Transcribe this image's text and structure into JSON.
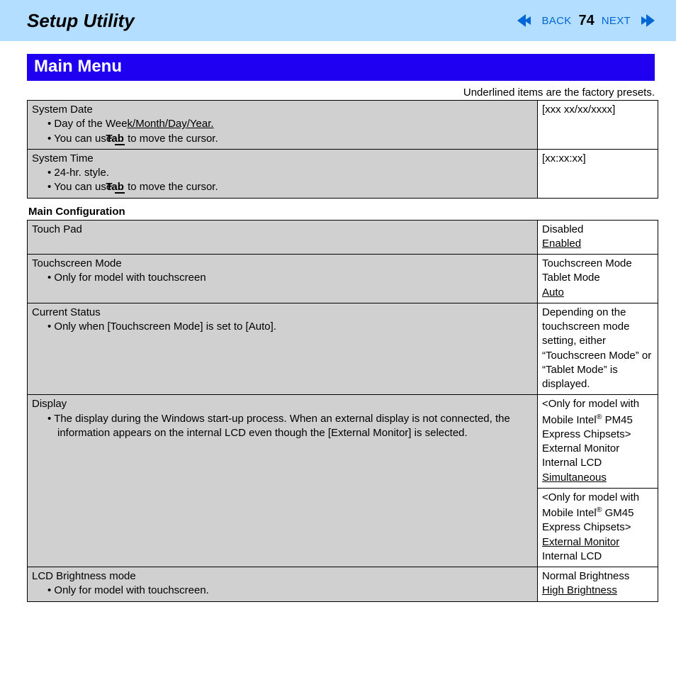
{
  "header": {
    "title": "Setup Utility",
    "back": "BACK",
    "page": "74",
    "next": "NEXT"
  },
  "section_title": "Main Menu",
  "note": "Underlined items are the factory presets.",
  "table1": {
    "r0": {
      "title": "System Date",
      "b1a": "Day of the Wee",
      "b1b": "k/Month/Day/Year.",
      "b2a": "You can use ",
      "b2key": "Tab",
      "b2b": " to move the cursor.",
      "value": "[xxx xx/xx/xxxx]"
    },
    "r1": {
      "title": "System Time",
      "b1": "24-hr. style.",
      "b2a": "You can use ",
      "b2key": "Tab",
      "b2b": " to move the cursor.",
      "value": "[xx:xx:xx]"
    }
  },
  "subhead": "Main Configuration",
  "table2": {
    "r0": {
      "title": "Touch Pad",
      "v1": "Disabled",
      "v2": "Enabled"
    },
    "r1": {
      "title": "Touchscreen Mode",
      "b1": "Only for model with touchscreen",
      "v1": "Touchscreen Mode",
      "v2": "Tablet Mode",
      "v3": "Auto"
    },
    "r2": {
      "title": "Current Status",
      "b1": "Only when [Touchscreen Mode] is set to [Auto].",
      "v": "Depending on the touchscreen mode setting, either “Touchscreen Mode” or “Tablet Mode” is displayed."
    },
    "r3": {
      "title": "Display",
      "b1": "The display during the Windows start-up process. When an external display is not connected, the information appears on the internal LCD even though the [External Monitor] is selected.",
      "v1a": "<Only for model with Mobile Intel",
      "v1reg": "®",
      "v1b": " PM45 Express Chipsets>",
      "v1c": "External Monitor",
      "v1d": "Internal LCD",
      "v1e": "Simultaneous",
      "v2a": "<Only for model with Mobile Intel",
      "v2reg": "®",
      "v2b": " GM45 Express Chipsets>",
      "v2c": "External Monitor",
      "v2d": "Internal LCD"
    },
    "r4": {
      "title": "LCD Brightness mode",
      "b1": "Only for model with touchscreen.",
      "v1": "Normal Brightness",
      "v2": "High Brightness"
    }
  }
}
